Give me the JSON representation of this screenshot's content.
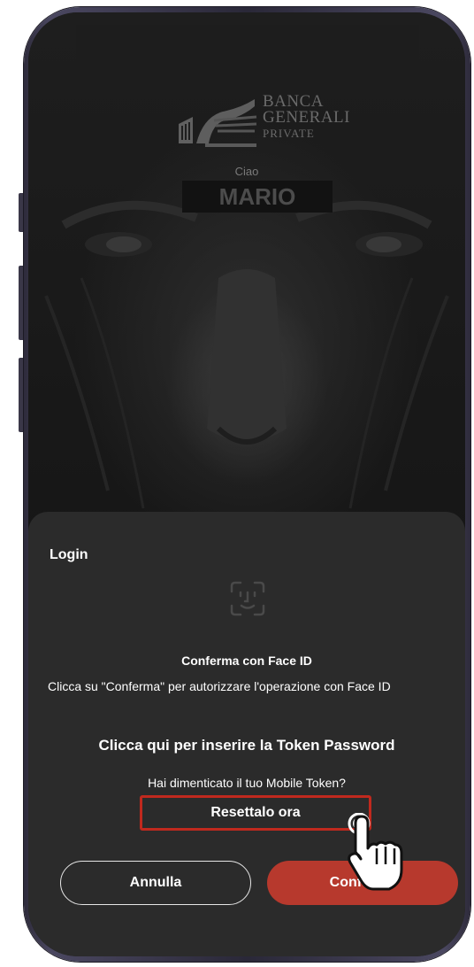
{
  "background": {
    "greeting": "Ciao",
    "username": "MARIO"
  },
  "logo": {
    "line1": "BANCA",
    "line2": "GENERALI",
    "line3": "PRIVATE",
    "icon": "winged-lion-logo-icon"
  },
  "sheet": {
    "title": "Login",
    "icon": "face-id-icon",
    "confirm_title": "Conferma con Face ID",
    "confirm_description": "Clicca su \"Conferma\" per autorizzare l'operazione con Face ID",
    "token_link": "Clicca qui per inserire la Token Password",
    "forgot_text": "Hai dimenticato il tuo Mobile Token?",
    "reset_label": "Resettalo ora",
    "cancel_label": "Annulla",
    "confirm_label": "Conferma"
  },
  "overlay": {
    "cursor_icon": "hand-pointer-icon",
    "highlight_color": "#c0291e"
  },
  "colors": {
    "accent": "#b7392d",
    "sheet_background": "#2b2b2b"
  }
}
